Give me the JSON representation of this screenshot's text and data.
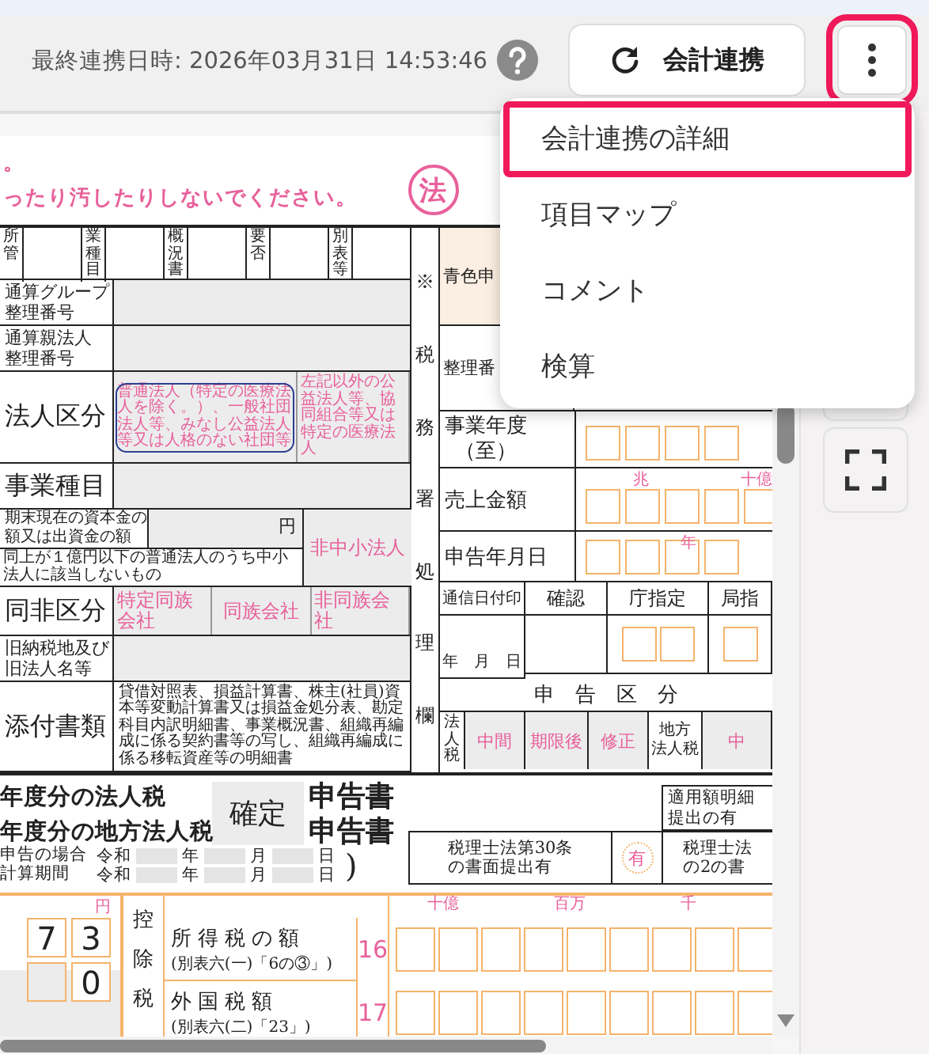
{
  "header": {
    "sync_status": "最終連携日時: 2026年03月31日 14:53:46",
    "sync_button": "会計連携",
    "more_button": {
      "highlighted": true
    }
  },
  "menu": {
    "items": [
      {
        "label": "会計連携の詳細",
        "highlighted": true
      },
      {
        "label": "項目マップ",
        "highlighted": false
      },
      {
        "label": "コメント",
        "highlighted": false
      },
      {
        "label": "検算",
        "highlighted": false
      }
    ]
  },
  "form": {
    "notice_lines": [
      "。",
      "ったり汚したりしないでください。"
    ],
    "stamp": "法",
    "office_cells": [
      "所管",
      "業種目",
      "概況書",
      "要否",
      "別表等"
    ],
    "left_rows": [
      {
        "kind": "field",
        "label_lines": [
          "通算グループ",
          "整理番号"
        ]
      },
      {
        "kind": "field",
        "label_lines": [
          "通算親法人",
          "整理番号"
        ]
      },
      {
        "kind": "options",
        "label": "法人区分",
        "options": [
          {
            "text": "普通法人（特定の医療法人を除く。）、一般社団法人等、みなし公益法人等又は人格のない社団等",
            "circled": true
          },
          {
            "text": "左記以外の公益法人等、協同組合等又は特定の医療法人",
            "circled": false
          }
        ]
      },
      {
        "kind": "field",
        "label_lines": [
          "事業種目"
        ]
      },
      {
        "kind": "capital",
        "label_lines": [
          "期末現在の資本金の",
          "額又は出資金の額"
        ],
        "unit": "円",
        "note": "同上が１億円以下の普通法人のうち中小法人に該当しないもの",
        "option": "非中小法人"
      },
      {
        "kind": "options",
        "label": "同非区分",
        "options": [
          {
            "text": "特定同族会社",
            "circled": false
          },
          {
            "text": "同族会社",
            "circled": false
          },
          {
            "text": "非同族会社",
            "circled": false
          }
        ]
      },
      {
        "kind": "field",
        "label_lines": [
          "旧納税地及び",
          "旧法人名等"
        ]
      },
      {
        "kind": "text",
        "label": "添付書類",
        "text": "貸借対照表、損益計算書、株主(社員)資本等変動計算書又は損益金処分表、勘定科目内訳明細書、事業概況書、組織再編成に係る契約書等の写し、組織再編成に係る移転資産等の明細書"
      }
    ],
    "office_column": "※税務署処理欄",
    "right_rows": {
      "blue_return": "青色申",
      "ref_number": "整理番",
      "fiscal_year": [
        "事業年度",
        "（至）"
      ],
      "sales": {
        "label": "売上金額",
        "units": [
          "兆",
          "十億"
        ]
      },
      "filing_date": {
        "label": "申告年月日",
        "unit": "年"
      },
      "processing": {
        "headers": [
          "通信日付印",
          "確認",
          "庁指定",
          "局指"
        ],
        "date": "年　月　日"
      },
      "filing_class": {
        "title": "申　告　区　分",
        "corporate_tax": "法人税",
        "corporate_options": [
          "中間",
          "期限後",
          "修正"
        ],
        "local_tax": [
          "地方",
          "法人税"
        ],
        "local_options": [
          "中"
        ]
      }
    },
    "title": {
      "lines": [
        "年度分の法人税",
        "年度分の地方法人税"
      ],
      "kind_box": "確定",
      "suffixes": [
        "申告書",
        "申告書"
      ]
    },
    "period": {
      "label_lines": [
        "申告の場合",
        "計算期間"
      ],
      "rows": [
        [
          "令和",
          "年",
          "月",
          "日"
        ],
        [
          "令和",
          "年",
          "月",
          "日"
        ]
      ],
      "closing": ")"
    },
    "statements": {
      "applied_detail": [
        "適用額明細",
        "提出の有"
      ],
      "article_30": [
        "税理士法第30条",
        "の書面提出有"
      ],
      "article_30_mark": "有",
      "article_33": [
        "税理士法",
        "の2の書"
      ]
    },
    "amounts": {
      "unit": "円",
      "digit_rows": [
        [
          "7",
          "3"
        ],
        [
          "0"
        ]
      ],
      "deduction": "控除税",
      "place_labels": [
        "十億",
        "百万",
        "千"
      ],
      "rows": [
        {
          "label": "所得税の額",
          "sub": "(別表六(一)「6の③」)",
          "number": "16"
        },
        {
          "label": "外国税額",
          "sub": "(別表六(二)「23」)",
          "number": "17"
        }
      ]
    }
  }
}
